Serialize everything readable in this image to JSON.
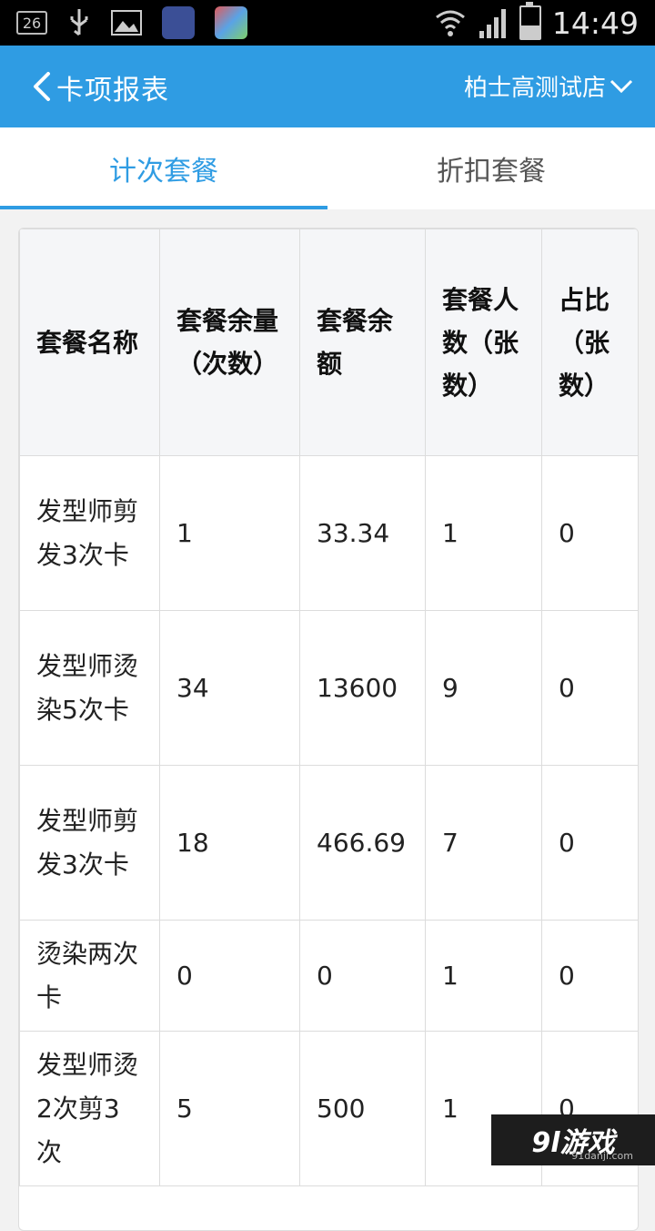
{
  "status_bar": {
    "notification_badge": "26",
    "time": "14:49"
  },
  "appbar": {
    "title": "卡项报表",
    "store_name": "柏士高测试店"
  },
  "tabs": [
    {
      "label": "计次套餐",
      "active": true
    },
    {
      "label": "折扣套餐",
      "active": false
    }
  ],
  "table": {
    "headers": [
      "套餐名称",
      "套餐余量（次数）",
      "套餐余额",
      "套餐人数（张数）",
      "占比（张数）"
    ],
    "rows": [
      [
        "发型师剪发3次卡",
        "1",
        "33.34",
        "1",
        "0"
      ],
      [
        "发型师烫染5次卡",
        "34",
        "13600",
        "9",
        "0"
      ],
      [
        "发型师剪发3次卡",
        "18",
        "466.69",
        "7",
        "0"
      ],
      [
        "烫染两次卡",
        "0",
        "0",
        "1",
        "0"
      ],
      [
        "发型师烫2次剪3次",
        "5",
        "500",
        "1",
        "0"
      ]
    ]
  },
  "watermark": {
    "main": "9l游戏",
    "sub": "91danji.com"
  },
  "colors": {
    "accent": "#2f9ce3"
  }
}
